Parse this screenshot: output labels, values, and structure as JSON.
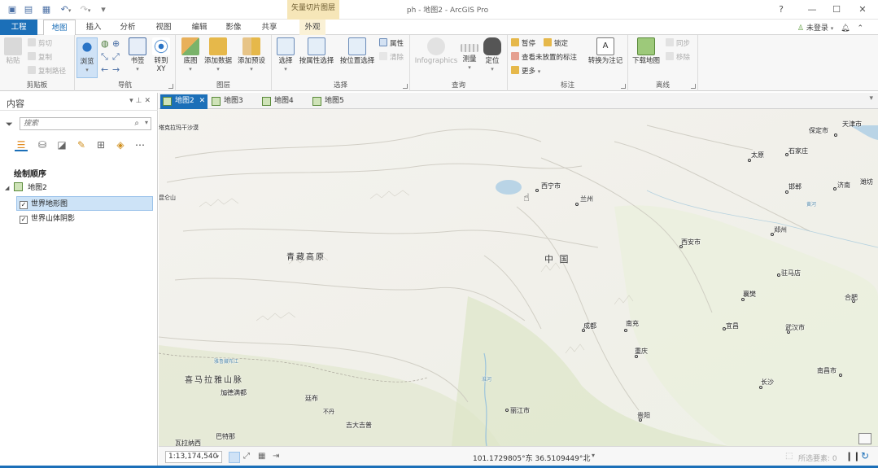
{
  "titlebar": {
    "title": "ph - 地图2 - ArcGIS Pro",
    "context_tab_group": "矢量切片图层",
    "help": "?",
    "minimize": "—",
    "maximize": "☐",
    "close": "✕"
  },
  "tabs": [
    "工程",
    "地图",
    "插入",
    "分析",
    "视图",
    "编辑",
    "影像",
    "共享",
    "外观"
  ],
  "account": {
    "label": "未登录"
  },
  "ribbon": {
    "clipboard": {
      "label": "剪贴板",
      "paste": "粘贴",
      "cut": "剪切",
      "copy": "复制",
      "copy_path": "复制路径"
    },
    "navigate": {
      "label": "导航",
      "explore": "浏览",
      "bookmarks": "书签",
      "goto_line1": "转到",
      "goto_line2": "XY"
    },
    "layer": {
      "label": "图层",
      "basemap": "底图",
      "add_data": "添加数据",
      "add_preset": "添加预设"
    },
    "selection": {
      "label": "选择",
      "select": "选择",
      "select_by_attr": "按属性选择",
      "select_by_loc": "按位置选择",
      "attributes": "属性",
      "clear": "清除"
    },
    "inquiry": {
      "label": "查询",
      "infographics": "Infographics",
      "measure": "测量",
      "locate": "定位"
    },
    "labeling": {
      "label": "标注",
      "pause": "暂停",
      "lock": "锁定",
      "view_unplaced": "查看未放置的标注",
      "more": "更多",
      "convert": "转换为注记"
    },
    "offline": {
      "label": "离线",
      "download_map": "下载地图",
      "sync": "同步",
      "remove": "移除"
    }
  },
  "contents": {
    "title": "内容",
    "search_placeholder": "搜索",
    "draw_order": "绘制顺序",
    "map_name": "地图2",
    "layers": [
      {
        "name": "世界地形图",
        "checked": true,
        "selected": true
      },
      {
        "name": "世界山体阴影",
        "checked": true,
        "selected": false
      }
    ]
  },
  "doc_tabs": [
    "地图2",
    "地图3",
    "地图4",
    "地图5"
  ],
  "map": {
    "regions": [
      "青藏高原",
      "中 国",
      "喜马拉雅山脉"
    ],
    "cities": [
      "塔克拉玛干沙漠",
      "西宁市",
      "兰州",
      "保定市",
      "天津市",
      "太原",
      "石家庄",
      "济南",
      "潍坊",
      "邯郸",
      "郑州",
      "西安市",
      "驻马店",
      "襄樊",
      "合肥",
      "成都",
      "南充",
      "宜昌",
      "武汉市",
      "重庆",
      "长沙",
      "南昌市",
      "加德满都",
      "廷布",
      "不丹",
      "丽江市",
      "吉大吉普",
      "贵阳",
      "巴特那",
      "瓦拉纳西",
      "昆仑山",
      "雅鲁藏布江",
      "黄河",
      "淮河"
    ]
  },
  "statusbar": {
    "scale": "1:13,174,540",
    "coords": "101.1729805°东 36.5109449°北",
    "selected": "所选要素: 0"
  }
}
